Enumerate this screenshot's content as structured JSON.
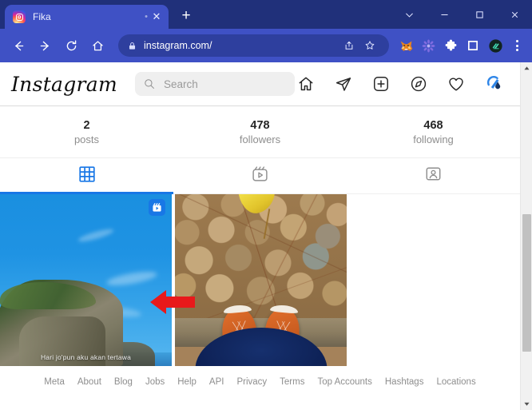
{
  "browser": {
    "tab": {
      "title": "Fika",
      "favicon": "instagram-favicon",
      "close_label": "✕",
      "dot_label": "•"
    },
    "new_tab_label": "+",
    "window_controls": {
      "expand": "chevron-down",
      "minimize": "−",
      "maximize": "□",
      "close": "✕"
    },
    "toolbar": {
      "back_label": "←",
      "forward_label": "→",
      "reload_label": "↻",
      "home_label": "⌂",
      "url": "instagram.com/",
      "lock_icon": "lock-icon",
      "share_icon": "share-icon",
      "bookmark_icon": "star-icon",
      "extensions": [
        "metamask-fox-icon",
        "purple-flower-icon",
        "puzzle-piece-icon",
        "square-extension-icon",
        "dark-circle-extension-icon"
      ],
      "menu_label": "⋮"
    }
  },
  "instagram": {
    "logo": "Instagram",
    "search": {
      "placeholder": "Search",
      "value": "",
      "icon": "search-icon"
    },
    "nav_icons": [
      "home-icon",
      "direct-message-icon",
      "new-post-icon",
      "explore-icon",
      "activity-heart-icon",
      "profile-avatar"
    ],
    "stats": [
      {
        "number": "2",
        "label": "posts"
      },
      {
        "number": "478",
        "label": "followers"
      },
      {
        "number": "468",
        "label": "following"
      }
    ],
    "tabs": [
      {
        "name": "grid-tab",
        "icon": "grid-icon",
        "active": true
      },
      {
        "name": "reels-tab",
        "icon": "reels-icon",
        "active": false
      },
      {
        "name": "tagged-tab",
        "icon": "tagged-icon",
        "active": false
      }
    ],
    "posts": [
      {
        "type": "reel",
        "badge": "reels-icon",
        "caption": "Hari jo'pun aku akan tertawa",
        "alt": "cliff with blue sky"
      },
      {
        "type": "photo",
        "badge": "",
        "caption": "",
        "alt": "orange shoes on cobblestones"
      }
    ],
    "footer_links": [
      "Meta",
      "About",
      "Blog",
      "Jobs",
      "Help",
      "API",
      "Privacy",
      "Terms",
      "Top Accounts",
      "Hashtags",
      "Locations"
    ]
  },
  "annotation": {
    "type": "red-arrow",
    "direction": "left",
    "color": "#e8191b"
  },
  "colors": {
    "browser_titlebar": "#20307a",
    "browser_toolbar": "#3f51c5",
    "omnibox": "#2e3f9e",
    "ig_accent": "#1877e6",
    "ig_text": "#262626",
    "ig_muted": "#8e8e8e"
  }
}
